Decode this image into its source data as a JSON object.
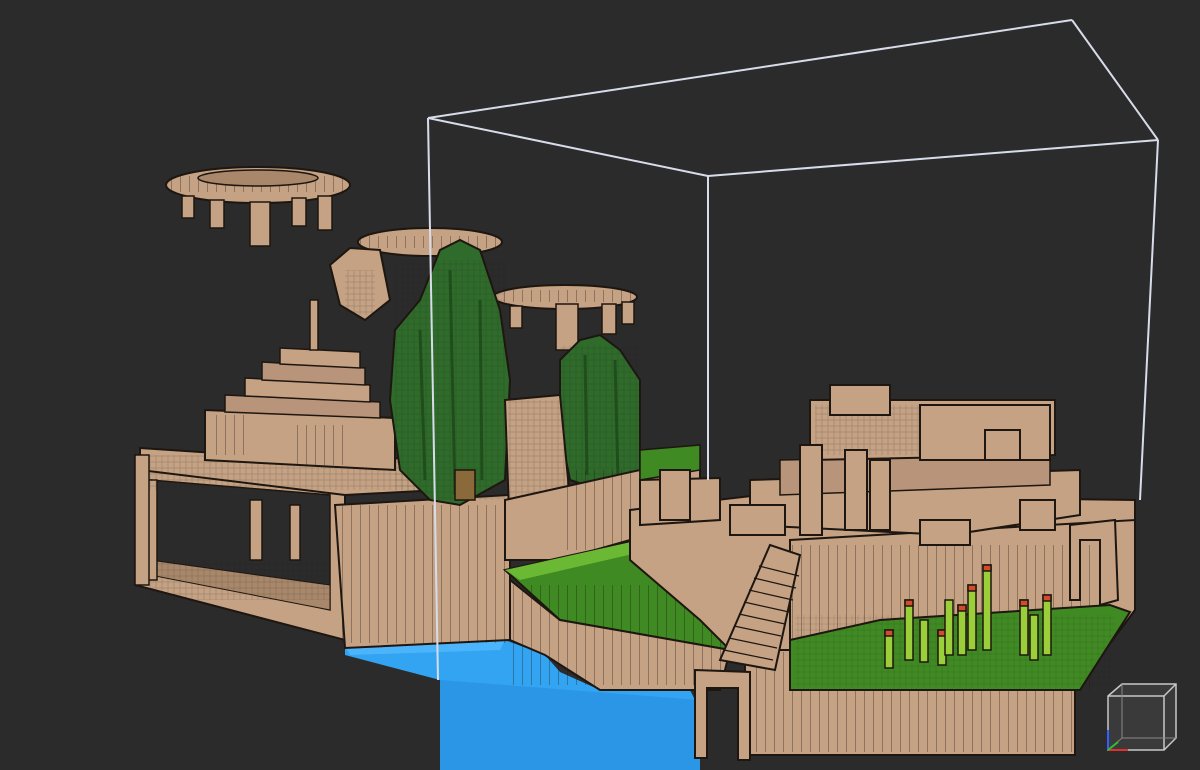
{
  "viewport": {
    "background": "#2b2b2b",
    "content": "voxel-scene"
  },
  "palette": {
    "terrain": "#c4a283",
    "terrain_shade": "#a8876a",
    "outline": "#1e1610",
    "grass": "#3f8a22",
    "grass_light": "#6ab834",
    "foliage": "#2f6b2a",
    "foliage_dark": "#1f4e1c",
    "crystal": "#9bcf3a",
    "crystal_tip": "#d24b2a",
    "water": "#33a4f2",
    "selection": "#d8dcea",
    "gizmo": "#c8c8c8"
  },
  "selection_box": {
    "visible": true
  },
  "orientation_cube": {
    "visible": true
  }
}
